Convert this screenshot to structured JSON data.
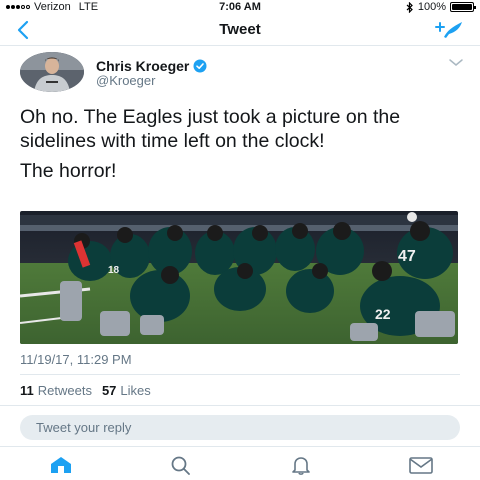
{
  "status_bar": {
    "carrier": "Verizon",
    "network": "LTE",
    "time": "7:06 AM",
    "battery": "100%",
    "battery_level": 1.0,
    "bluetooth_icon": "bluetooth-icon"
  },
  "nav": {
    "title": "Tweet",
    "back_icon": "back-chevron-icon",
    "compose_icon": "compose-tweet-icon"
  },
  "tweet": {
    "author_name": "Chris Kroeger",
    "author_handle": "@Kroeger",
    "verified": true,
    "text_line1": "Oh no. The Eagles just took a picture on the sidelines with time left on the clock!",
    "text_line2": "The horror!",
    "timestamp": "11/19/17, 11:29 PM",
    "retweets_count": "11",
    "retweets_label": "Retweets",
    "likes_count": "57",
    "likes_label": "Likes"
  },
  "reply": {
    "placeholder": "Tweet your reply"
  },
  "tab_bar": {
    "items": [
      {
        "icon": "home-icon",
        "active": true
      },
      {
        "icon": "search-icon",
        "active": false
      },
      {
        "icon": "notifications-icon",
        "active": false
      },
      {
        "icon": "messages-icon",
        "active": false
      }
    ]
  },
  "colors": {
    "accent": "#1da1f2",
    "text": "#14171a",
    "secondary_text": "#657786",
    "divider": "#e1e8ed",
    "reply_bg": "#e6ecf0"
  }
}
